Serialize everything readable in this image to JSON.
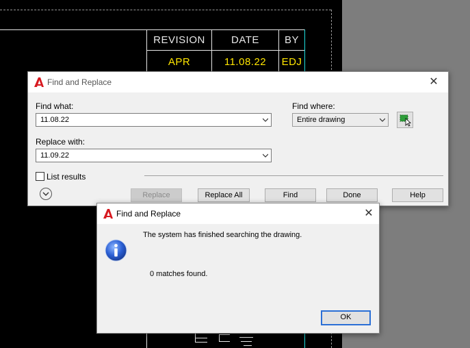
{
  "drawing": {
    "headers": [
      "REVISION",
      "DATE",
      "BY"
    ],
    "row": [
      "APR",
      "11.08.22",
      "EDJ"
    ]
  },
  "find_replace": {
    "title": "Find and Replace",
    "find_what_label": "Find what:",
    "find_what_value": "11.08.22",
    "replace_with_label": "Replace with:",
    "replace_with_value": "11.09.22",
    "find_where_label": "Find where:",
    "find_where_value": "Entire drawing",
    "list_results_label": "List results",
    "list_results_checked": false,
    "buttons": {
      "replace": "Replace",
      "replace_all": "Replace All",
      "find": "Find",
      "done": "Done",
      "help": "Help"
    }
  },
  "message": {
    "title": "Find and Replace",
    "line1": "The system has finished searching the drawing.",
    "line2": "0 matches found.",
    "ok": "OK"
  },
  "colors": {
    "accent": "#2a6fd6",
    "cad_background": "#000000",
    "cad_yellow": "#ffe600",
    "cad_cyan": "#1ee0e0",
    "autocad_red": "#d71920"
  }
}
